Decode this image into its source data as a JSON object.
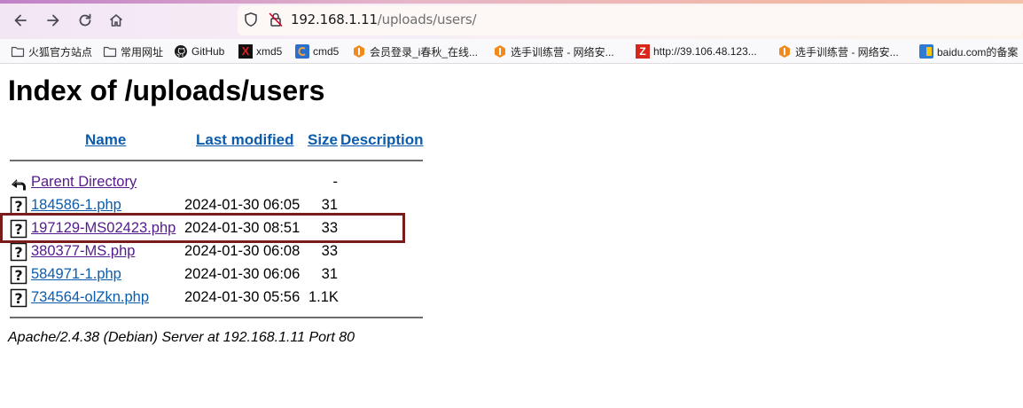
{
  "browser": {
    "url_host": "192.168.1.11",
    "url_path": "/uploads/users/"
  },
  "bookmarks": [
    {
      "label": "火狐官方站点",
      "icon": "folder-icon"
    },
    {
      "label": "常用网址",
      "icon": "folder-icon"
    },
    {
      "label": "GitHub",
      "icon": "github-icon"
    },
    {
      "label": "xmd5",
      "icon": "xmd5-icon"
    },
    {
      "label": "cmd5",
      "icon": "cmd5-icon"
    },
    {
      "label": "会员登录_i春秋_在线...",
      "icon": "ichunqiu-icon"
    },
    {
      "label": "选手训练营 - 网络安...",
      "icon": "ichunqiu-icon"
    },
    {
      "label": "http://39.106.48.123...",
      "icon": "z-icon"
    },
    {
      "label": "选手训练营 - 网络安...",
      "icon": "ichunqiu-icon"
    },
    {
      "label": "baidu.com的备案",
      "icon": "baidu-icon"
    }
  ],
  "page": {
    "title": "Index of /uploads/users",
    "columns": {
      "name": "Name",
      "last_modified": "Last modified",
      "size": "Size",
      "description": "Description"
    },
    "parent": {
      "name": "Parent Directory",
      "size": "-"
    },
    "files": [
      {
        "name": "184586-1.php",
        "modified": "2024-01-30 06:05",
        "size": "31"
      },
      {
        "name": "197129-MS02423.php",
        "modified": "2024-01-30 08:51",
        "size": "33"
      },
      {
        "name": "380377-MS.php",
        "modified": "2024-01-30 06:08",
        "size": "33"
      },
      {
        "name": "584971-1.php",
        "modified": "2024-01-30 06:06",
        "size": "31"
      },
      {
        "name": "734564-olZkn.php",
        "modified": "2024-01-30 05:56",
        "size": "1.1K"
      }
    ],
    "footer": "Apache/2.4.38 (Debian) Server at 192.168.1.11 Port 80"
  },
  "colors": {
    "link": "#0b5cad",
    "visited_link": "#551a8b",
    "highlight_border": "#7a1c1c"
  }
}
